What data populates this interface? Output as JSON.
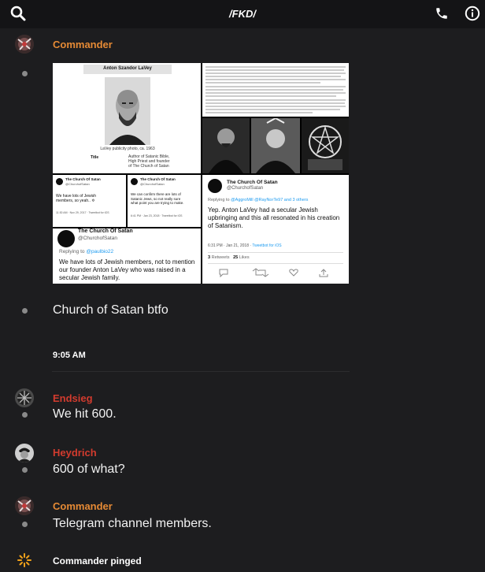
{
  "header": {
    "title": "/FKD/",
    "icons": [
      "search-icon",
      "phone-icon",
      "info-icon"
    ]
  },
  "messages": {
    "m1": {
      "author": "Commander",
      "author_color": "#e58a35",
      "text": "Church of Satan btfo"
    },
    "collage": {
      "laVey_card": {
        "heading": "Anton Szandor LaVey",
        "caption": "LaVey publicity photo, ca. 1963",
        "title_label": "Title",
        "title_value1": "Author of Satanic Bible,",
        "title_value2": "High Priest and founder",
        "title_value3": "of The Church of Satan"
      },
      "tweet_small_1": {
        "name": "The Church Of Satan",
        "handle": "@ChurchofSatan",
        "body": "We have lots of Jewish members, so yeah.. ✡",
        "meta": "11:30 AM · Nov 29, 2017 · Tweetbot for iOS"
      },
      "tweet_small_2": {
        "name": "The Church Of Satan",
        "handle": "@ChurchofSatan",
        "body": "We can confirm there are lots of Satanic Jews, so not really sure what point you are trying to make.",
        "meta": "6:41 PM · Jan 23, 2018 · Tweetbot for iOS"
      },
      "tweet_big": {
        "name": "The Church Of Satan",
        "handle": "@ChurchofSatan",
        "replying": "Replying to",
        "replying_to": "@paulbio22",
        "body": "We have lots of Jewish members, not to mention our founder Anton LaVey who was raised in a secular Jewish family."
      },
      "tweet_right": {
        "name": "The Church Of Satan",
        "handle": "@ChurchofSatan",
        "replying": "Replying to",
        "replying_to": "@AggroMill @RayNorTe97 and 3 others",
        "body": "Yep. Anton LaVey had a secular Jewish upbringing and this all resonated in his creation of Satanism.",
        "meta_time": "6:31 PM · Jan 21, 2018 · ",
        "meta_client": "Tweetbot for iOS",
        "retweets_count": "3",
        "retweets_label": "Retweets",
        "likes_count": "25",
        "likes_label": "Likes"
      }
    },
    "timestamp": "9:05 AM",
    "m2": {
      "author": "Endsieg",
      "author_color": "#d23b2e",
      "text": "We hit 600."
    },
    "m3": {
      "author": "Heydrich",
      "author_color": "#d23b2e",
      "text": "600 of what?"
    },
    "m4": {
      "author": "Commander",
      "author_color": "#e58a35",
      "text": "Telegram channel members."
    },
    "ping": {
      "text": "Commander pinged"
    }
  }
}
